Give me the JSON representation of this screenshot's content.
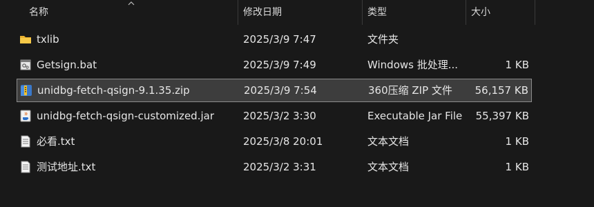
{
  "columns": {
    "name": "名称",
    "date": "修改日期",
    "type": "类型",
    "size": "大小"
  },
  "files": [
    {
      "name": "txlib",
      "date": "2025/3/9 7:47",
      "type": "文件夹",
      "size": "",
      "icon": "folder-icon",
      "selected": false
    },
    {
      "name": "Getsign.bat",
      "date": "2025/3/9 7:49",
      "type": "Windows 批处理...",
      "size": "1 KB",
      "icon": "batch-file-icon",
      "selected": false
    },
    {
      "name": "unidbg-fetch-qsign-9.1.35.zip",
      "date": "2025/3/9 7:54",
      "type": "360压缩 ZIP 文件",
      "size": "56,157 KB",
      "icon": "zip-archive-icon",
      "selected": true
    },
    {
      "name": "unidbg-fetch-qsign-customized.jar",
      "date": "2025/3/2 3:30",
      "type": "Executable Jar File",
      "size": "55,397 KB",
      "icon": "java-jar-icon",
      "selected": false
    },
    {
      "name": "必看.txt",
      "date": "2025/3/8 20:01",
      "type": "文本文档",
      "size": "1 KB",
      "icon": "text-file-icon",
      "selected": false
    },
    {
      "name": "测试地址.txt",
      "date": "2025/3/2 3:31",
      "type": "文本文档",
      "size": "1 KB",
      "icon": "text-file-icon",
      "selected": false
    }
  ],
  "colors": {
    "background": "#191919",
    "selected_row": "#3d3d3d",
    "selected_border": "#8c8c8c",
    "folder": "#f4c242"
  }
}
